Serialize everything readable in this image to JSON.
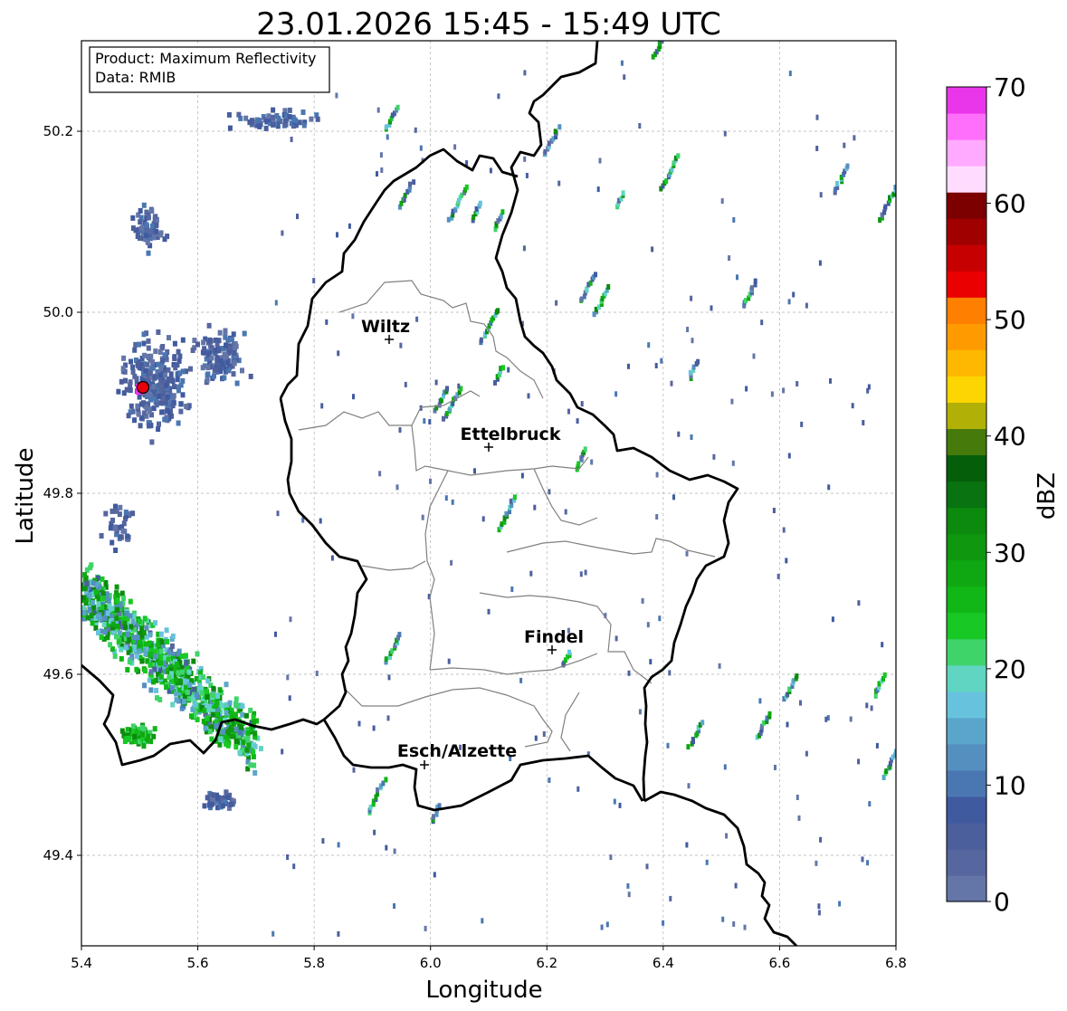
{
  "title": "23.01.2026 15:45 - 15:49 UTC",
  "xlabel": "Longitude",
  "ylabel": "Latitude",
  "x_ticks": [
    "5.4",
    "5.6",
    "5.8",
    "6.0",
    "6.2",
    "6.4",
    "6.6",
    "6.8"
  ],
  "y_ticks": [
    "49.4",
    "49.6",
    "49.8",
    "50.0",
    "50.2"
  ],
  "info_box": {
    "line1": "Product: Maximum Reflectivity",
    "line2": "Data: RMIB"
  },
  "colorbar": {
    "label": "dBZ",
    "ticks": [
      "0",
      "10",
      "20",
      "30",
      "40",
      "50",
      "60",
      "70"
    ],
    "colors": [
      "#6475a8",
      "#56669f",
      "#4b5f9c",
      "#405a9f",
      "#4a77b1",
      "#558fc0",
      "#5aa6cb",
      "#67c3dd",
      "#60d5c2",
      "#3ed46a",
      "#18c824",
      "#10b716",
      "#10a812",
      "#0f9710",
      "#0c8a0d",
      "#087310",
      "#055e0a",
      "#467a0a",
      "#b0b007",
      "#fdd500",
      "#ffb800",
      "#ff9b00",
      "#ff7f00",
      "#ea0000",
      "#c60000",
      "#a10000",
      "#7c0000",
      "#ffdcff",
      "#ffaaff",
      "#ff6ffc",
      "#ea36ea"
    ]
  },
  "cities": [
    {
      "name": "Wiltz",
      "lon": 5.93,
      "lat": 49.97
    },
    {
      "name": "Ettelbruck",
      "lon": 6.1,
      "lat": 49.85
    },
    {
      "name": "Findel",
      "lon": 6.21,
      "lat": 49.63
    },
    {
      "name": "Esch/Alzette",
      "lon": 5.99,
      "lat": 49.5
    }
  ],
  "radar_marker": {
    "lon": 5.505,
    "lat": 49.915,
    "color": "#e8000a"
  },
  "map_extent": {
    "lon": [
      5.4,
      6.8
    ],
    "lat": [
      49.3,
      50.3
    ]
  },
  "chart_data": {
    "type": "heatmap",
    "title": "23.01.2026 15:45 - 15:49 UTC",
    "xlabel": "Longitude",
    "ylabel": "Latitude",
    "xlim": [
      5.4,
      6.8
    ],
    "ylim": [
      49.3,
      50.3
    ],
    "grid": true,
    "colorbar_label": "dBZ",
    "colorbar_range": [
      0,
      70
    ]
  }
}
